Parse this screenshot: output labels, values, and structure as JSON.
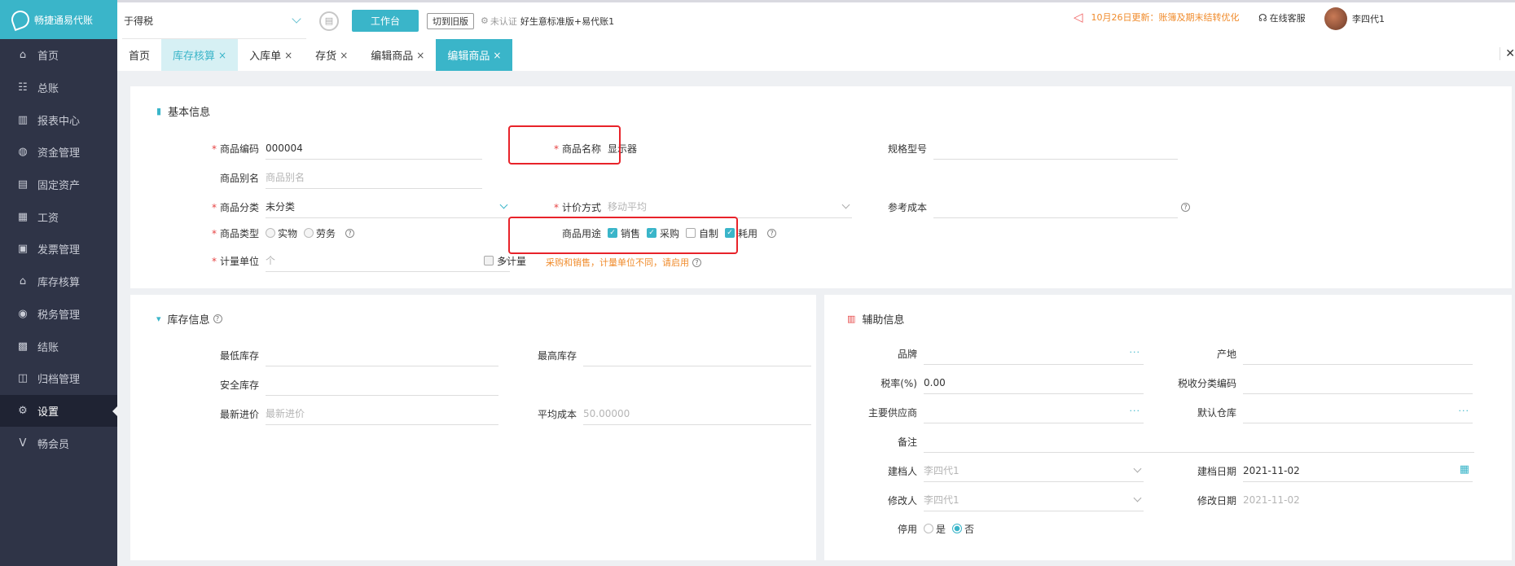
{
  "sidebar": {
    "logo_text": "畅捷通易代账",
    "items": [
      {
        "label": "首页",
        "icon": "home-icon",
        "glyph": "⌂"
      },
      {
        "label": "总账",
        "icon": "ledger-icon",
        "glyph": "☷"
      },
      {
        "label": "报表中心",
        "icon": "chart-icon",
        "glyph": "▥"
      },
      {
        "label": "资金管理",
        "icon": "wallet-icon",
        "glyph": "◍"
      },
      {
        "label": "固定资产",
        "icon": "asset-icon",
        "glyph": "▤"
      },
      {
        "label": "工资",
        "icon": "salary-icon",
        "glyph": "▦"
      },
      {
        "label": "发票管理",
        "icon": "invoice-icon",
        "glyph": "▣"
      },
      {
        "label": "库存核算",
        "icon": "warehouse-icon",
        "glyph": "⌂"
      },
      {
        "label": "税务管理",
        "icon": "tax-icon",
        "glyph": "◉"
      },
      {
        "label": "结账",
        "icon": "close-account-icon",
        "glyph": "▩"
      },
      {
        "label": "归档管理",
        "icon": "archive-icon",
        "glyph": "◫"
      },
      {
        "label": "设置",
        "icon": "gear-icon",
        "glyph": "⚙"
      },
      {
        "label": "畅会员",
        "icon": "vip-icon",
        "glyph": "V"
      }
    ],
    "active_index": 11
  },
  "topbar": {
    "company": "于得税",
    "workbench_label": "工作台",
    "old_version_label": "切到旧版",
    "cert_status": "未认证",
    "plan": "好生意标准版+易代账1",
    "announcement": "10月26日更新：账簿及期末结转优化",
    "service_label": "在线客服",
    "user_name": "李四代1"
  },
  "tabs": [
    {
      "label": "首页",
      "closable": false,
      "state": "normal"
    },
    {
      "label": "库存核算",
      "closable": true,
      "state": "light"
    },
    {
      "label": "入库单",
      "closable": true,
      "state": "normal"
    },
    {
      "label": "存货",
      "closable": true,
      "state": "normal"
    },
    {
      "label": "编辑商品",
      "closable": true,
      "state": "normal"
    },
    {
      "label": "编辑商品",
      "closable": true,
      "state": "active"
    }
  ],
  "basic": {
    "title": "基本信息",
    "code_label": "商品编码",
    "code_value": "000004",
    "name_label": "商品名称",
    "name_value": "显示器",
    "spec_label": "规格型号",
    "spec_value": "",
    "alias_label": "商品别名",
    "alias_placeholder": "商品别名",
    "category_label": "商品分类",
    "category_value": "未分类",
    "pricing_label": "计价方式",
    "pricing_value": "移动平均",
    "ref_cost_label": "参考成本",
    "ref_cost_value": "",
    "type_label": "商品类型",
    "type_options": [
      "实物",
      "劳务"
    ],
    "usage_label": "商品用途",
    "usage_options": [
      {
        "label": "销售",
        "checked": true
      },
      {
        "label": "采购",
        "checked": true
      },
      {
        "label": "自制",
        "checked": false
      },
      {
        "label": "耗用",
        "checked": true
      }
    ],
    "unit_label": "计量单位",
    "unit_placeholder": "个",
    "multi_unit_label": "多计量",
    "unit_warning": "采购和销售，计量单位不同，请启用"
  },
  "stock": {
    "title": "库存信息",
    "min_label": "最低库存",
    "min_value": "",
    "max_label": "最高库存",
    "max_value": "",
    "safe_label": "安全库存",
    "safe_value": "",
    "last_price_label": "最新进价",
    "last_price_placeholder": "最新进价",
    "avg_cost_label": "平均成本",
    "avg_cost_value": "50.00000"
  },
  "aux": {
    "title": "辅助信息",
    "brand_label": "品牌",
    "origin_label": "产地",
    "tax_rate_label": "税率(%)",
    "tax_rate_value": "0.00",
    "tax_code_label": "税收分类编码",
    "supplier_label": "主要供应商",
    "warehouse_label": "默认仓库",
    "note_label": "备注",
    "creator_label": "建档人",
    "creator_value": "李四代1",
    "create_date_label": "建档日期",
    "create_date_value": "2021-11-02",
    "modifier_label": "修改人",
    "modifier_value": "李四代1",
    "modify_date_label": "修改日期",
    "modify_date_value": "2021-11-02",
    "disable_label": "停用",
    "disable_options": [
      "是",
      "否"
    ],
    "disable_selected": 1
  },
  "colors": {
    "accent": "#3ab5c9",
    "sidebar": "#2f3447",
    "highlight": "#e8232a",
    "warning": "#f08b2b"
  }
}
